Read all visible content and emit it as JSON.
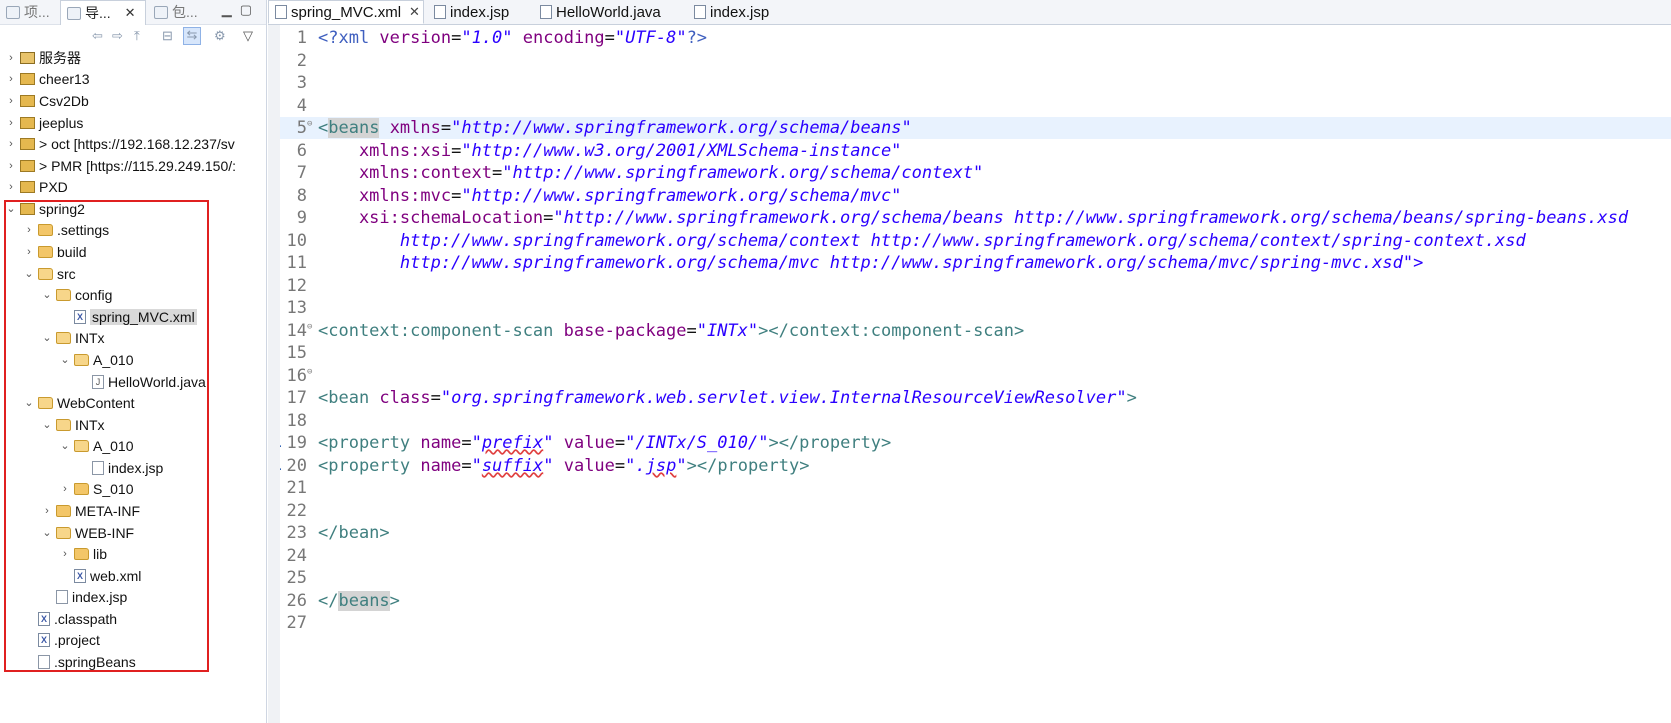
{
  "left_tabs": [
    {
      "label": "项...",
      "active": false
    },
    {
      "label": "导...",
      "active": true
    },
    {
      "label": "包...",
      "active": false
    }
  ],
  "tree": [
    {
      "label": "服务器",
      "indent": 0,
      "arrow": "›",
      "icon": "server"
    },
    {
      "label": "cheer13",
      "indent": 0,
      "arrow": "›",
      "icon": "project"
    },
    {
      "label": "Csv2Db",
      "indent": 0,
      "arrow": "›",
      "icon": "project"
    },
    {
      "label": "jeeplus",
      "indent": 0,
      "arrow": "›",
      "icon": "project"
    },
    {
      "label": "> oct  [https://192.168.12.237/sv",
      "indent": 0,
      "arrow": "›",
      "icon": "project"
    },
    {
      "label": "> PMR  [https://115.29.249.150/:",
      "indent": 0,
      "arrow": "›",
      "icon": "project"
    },
    {
      "label": "PXD",
      "indent": 0,
      "arrow": "›",
      "icon": "project"
    },
    {
      "label": "spring2",
      "indent": 0,
      "arrow": "⌄",
      "icon": "project"
    },
    {
      "label": ".settings",
      "indent": 1,
      "arrow": "›",
      "icon": "folder"
    },
    {
      "label": "build",
      "indent": 1,
      "arrow": "›",
      "icon": "folder"
    },
    {
      "label": "src",
      "indent": 1,
      "arrow": "⌄",
      "icon": "folder-open"
    },
    {
      "label": "config",
      "indent": 2,
      "arrow": "⌄",
      "icon": "folder-open"
    },
    {
      "label": "spring_MVC.xml",
      "indent": 3,
      "arrow": "",
      "icon": "xml",
      "selected": true
    },
    {
      "label": "INTx",
      "indent": 2,
      "arrow": "⌄",
      "icon": "folder-open"
    },
    {
      "label": "A_010",
      "indent": 3,
      "arrow": "⌄",
      "icon": "folder-open"
    },
    {
      "label": "HelloWorld.java",
      "indent": 4,
      "arrow": "",
      "icon": "java"
    },
    {
      "label": "WebContent",
      "indent": 1,
      "arrow": "⌄",
      "icon": "folder-open"
    },
    {
      "label": "INTx",
      "indent": 2,
      "arrow": "⌄",
      "icon": "folder-open"
    },
    {
      "label": "A_010",
      "indent": 3,
      "arrow": "⌄",
      "icon": "folder-open"
    },
    {
      "label": "index.jsp",
      "indent": 4,
      "arrow": "",
      "icon": "jsp"
    },
    {
      "label": "S_010",
      "indent": 3,
      "arrow": "›",
      "icon": "folder"
    },
    {
      "label": "META-INF",
      "indent": 2,
      "arrow": "›",
      "icon": "folder"
    },
    {
      "label": "WEB-INF",
      "indent": 2,
      "arrow": "⌄",
      "icon": "folder-open"
    },
    {
      "label": "lib",
      "indent": 3,
      "arrow": "›",
      "icon": "folder"
    },
    {
      "label": "web.xml",
      "indent": 3,
      "arrow": "",
      "icon": "xml"
    },
    {
      "label": "index.jsp",
      "indent": 2,
      "arrow": "",
      "icon": "jsp"
    },
    {
      "label": ".classpath",
      "indent": 1,
      "arrow": "",
      "icon": "xml"
    },
    {
      "label": ".project",
      "indent": 1,
      "arrow": "",
      "icon": "xml"
    },
    {
      "label": ".springBeans",
      "indent": 1,
      "arrow": "",
      "icon": "jsp"
    }
  ],
  "editor_tabs": [
    {
      "label": "spring_MVC.xml",
      "active": true
    },
    {
      "label": "index.jsp",
      "active": false
    },
    {
      "label": "HelloWorld.java",
      "active": false
    },
    {
      "label": "index.jsp",
      "active": false
    }
  ],
  "code": {
    "line_numbers": [
      "1",
      "2",
      "3",
      "4",
      "5",
      "6",
      "7",
      "8",
      "9",
      "10",
      "11",
      "12",
      "13",
      "14",
      "15",
      "16",
      "17",
      "18",
      "19",
      "20",
      "21",
      "22",
      "23",
      "24",
      "25",
      "26",
      "27"
    ],
    "l1": {
      "a": "<?xml ",
      "b": "version",
      "c": "=",
      "d": "\"1.0\"",
      "e": " ",
      "f": "encoding",
      "g": "=",
      "h": "\"UTF-8\"",
      "i": "?>"
    },
    "l5": {
      "a": "<",
      "b": "beans",
      "c": " ",
      "d": "xmlns",
      "e": "=",
      "f": "\"http://www.springframework.org/schema/beans\""
    },
    "l6": {
      "a": "    xmlns:xsi",
      "b": "=",
      "c": "\"http://www.w3.org/2001/XMLSchema-instance\""
    },
    "l7": {
      "a": "    xmlns:context",
      "b": "=",
      "c": "\"http://www.springframework.org/schema/context\""
    },
    "l8": {
      "a": "    xmlns:mvc",
      "b": "=",
      "c": "\"http://www.springframework.org/schema/mvc\""
    },
    "l9": {
      "a": "    xsi:schemaLocation",
      "b": "=",
      "c": "\"http://www.springframework.org/schema/beans http://www.springframework.org/schema/beans/spring-beans.xsd"
    },
    "l10": "        http://www.springframework.org/schema/context http://www.springframework.org/schema/context/spring-context.xsd",
    "l11": "        http://www.springframework.org/schema/mvc http://www.springframework.org/schema/mvc/spring-mvc.xsd\">",
    "l14": {
      "a": "<context:component-scan",
      "b": " base-package",
      "c": "=",
      "d": "\"INTx\"",
      "e": "></context:component-scan>"
    },
    "l17": {
      "a": "<bean",
      "b": " class",
      "c": "=",
      "d": "\"org.springframework.web.servlet.view.InternalResourceViewResolver\"",
      "e": ">"
    },
    "l19": {
      "a": "<property",
      "b": " name",
      "c": "=",
      "d": "\"",
      "e": "prefix",
      "f": "\"",
      "g": " value",
      "h": "=",
      "i": "\"/INTx/S_010/\"",
      "j": "></property>"
    },
    "l20": {
      "a": "<property",
      "b": " name",
      "c": "=",
      "d": "\"",
      "e": "suffix",
      "f": "\"",
      "g": " value",
      "h": "=",
      "i": "\".",
      "j": "jsp",
      "k": "\"",
      "l": "></property>"
    },
    "l23": "</bean>",
    "l26": {
      "a": "</",
      "b": "beans",
      "c": ">"
    }
  }
}
